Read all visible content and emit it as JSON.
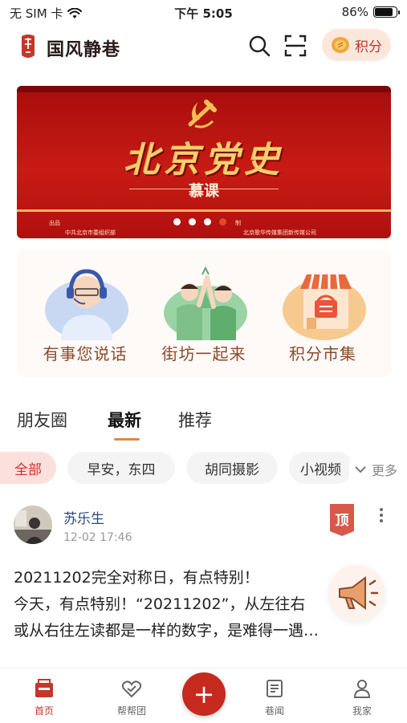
{
  "status_bar": {
    "carrier": "无 SIM 卡",
    "time": "下午 5:05",
    "battery": "86%",
    "battery_level": 0.86
  },
  "header": {
    "title": "国风静巷",
    "points_label": "积分",
    "accent": "#c0392b"
  },
  "banner": {
    "title": "北京党史",
    "subtitle": "慕课",
    "credit_left_a": "出品",
    "credit_left_b": "中共北京市委组织部",
    "credit_right_a": "制",
    "credit_right_b": "北京歌华传媒集团新传媒公司",
    "slide_count": 4,
    "active_slide": 4
  },
  "quick_actions": [
    {
      "label": "有事您说话",
      "icon": "customer-service-icon"
    },
    {
      "label": "街坊一起来",
      "icon": "neighbors-icon"
    },
    {
      "label": "积分市集",
      "icon": "market-shop-icon"
    }
  ],
  "feed_tabs": [
    {
      "label": "朋友圈",
      "active": false
    },
    {
      "label": "最新",
      "active": true
    },
    {
      "label": "推荐",
      "active": false
    }
  ],
  "categories": {
    "items": [
      "全部",
      "早安，东四",
      "胡同摄影",
      "小视频"
    ],
    "active": "全部",
    "more_label": "更多"
  },
  "post": {
    "author": "苏乐生",
    "time": "12-02 17:46",
    "pinned_label": "顶",
    "lines": [
      "20211202完全对称日，有点特别！",
      "今天，有点特别！“20211202”，从左往右",
      "或从右往左读都是一样的数字，是难得一遇…"
    ]
  },
  "bottom_nav": [
    {
      "label": "首页",
      "icon": "home-icon",
      "active": true
    },
    {
      "label": "帮帮团",
      "icon": "heart-hands-icon",
      "active": false
    },
    {
      "label": "巷闻",
      "icon": "news-icon",
      "active": false
    },
    {
      "label": "我家",
      "icon": "profile-icon",
      "active": false
    }
  ]
}
